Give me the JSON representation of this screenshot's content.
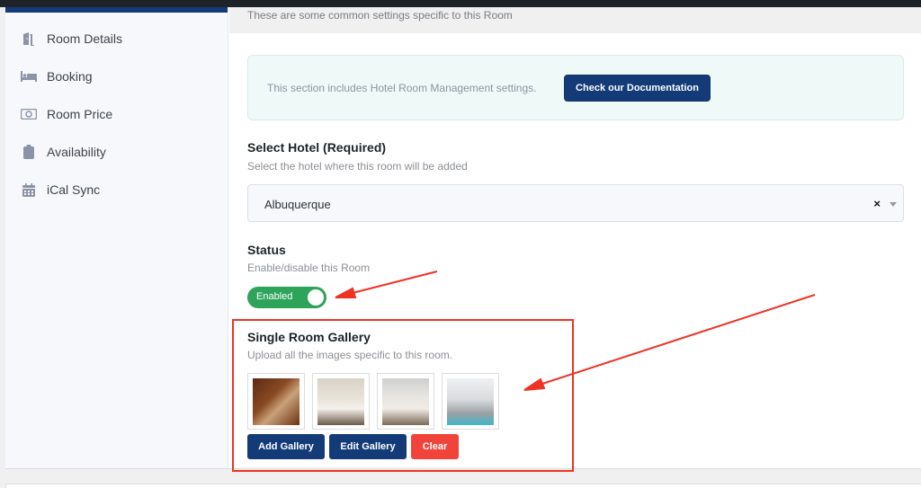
{
  "sidebar": {
    "items": [
      {
        "label": "Room Details",
        "icon": "door-open-icon"
      },
      {
        "label": "Booking",
        "icon": "bed-icon"
      },
      {
        "label": "Room Price",
        "icon": "money-bill-icon"
      },
      {
        "label": "Availability",
        "icon": "clipboard-icon"
      },
      {
        "label": "iCal Sync",
        "icon": "calendar-icon"
      }
    ]
  },
  "header": {
    "subtitle": "These are some common settings specific to this Room"
  },
  "notice": {
    "text": "This section includes Hotel Room Management settings.",
    "button_label": "Check our Documentation"
  },
  "hotel_field": {
    "label": "Select Hotel (Required)",
    "description": "Select the hotel where this room will be added",
    "value": "Albuquerque",
    "clear_symbol": "×"
  },
  "status_field": {
    "label": "Status",
    "description": "Enable/disable this Room",
    "toggle_label": "Enabled",
    "enabled": true
  },
  "gallery_field": {
    "label": "Single Room Gallery",
    "description": "Upload all the images specific to this room.",
    "images": [
      {
        "alt": "beer glass image"
      },
      {
        "alt": "hotel room image"
      },
      {
        "alt": "bedroom image"
      },
      {
        "alt": "living room image"
      }
    ],
    "buttons": {
      "add": "Add Gallery",
      "edit": "Edit Gallery",
      "clear": "Clear"
    }
  },
  "colors": {
    "primary": "#133b77",
    "success": "#2ea35a",
    "danger": "#f0443a",
    "annotation": "#ee3324"
  }
}
